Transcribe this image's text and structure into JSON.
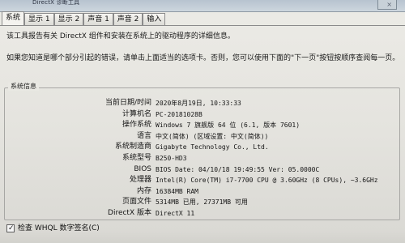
{
  "window": {
    "title": "DirectX 诊断工具",
    "close_icon": "close-icon"
  },
  "tabs": [
    {
      "label": "系统"
    },
    {
      "label": "显示 1"
    },
    {
      "label": "显示 2"
    },
    {
      "label": "声音 1"
    },
    {
      "label": "声音 2"
    },
    {
      "label": "输入"
    }
  ],
  "intro": {
    "line1": "该工具报告有关 DirectX 组件和安装在系统上的驱动程序的详细信息。",
    "line2": "如果您知道是哪个部分引起的错误，请单击上面适当的选项卡。否则，您可以使用下面的\"下一页\"按钮按顺序查阅每一页。"
  },
  "system_info": {
    "title": "系统信息",
    "rows": [
      {
        "label": "当前日期/时间",
        "value": "2020年8月19日, 10:33:33"
      },
      {
        "label": "计算机名",
        "value": "PC-20181028B"
      },
      {
        "label": "操作系统",
        "value": "Windows 7 旗舰版 64 位 (6.1, 版本 7601)"
      },
      {
        "label": "语言",
        "value": "中文(简体) (区域设置: 中文(简体))"
      },
      {
        "label": "系统制造商",
        "value": "Gigabyte Technology Co., Ltd."
      },
      {
        "label": "系统型号",
        "value": "B250-HD3"
      },
      {
        "label": "BIOS",
        "value": "BIOS Date: 04/10/18 19:49:55 Ver: 05.0000C"
      },
      {
        "label": "处理器",
        "value": "Intel(R) Core(TM) i7-7700 CPU @ 3.60GHz (8 CPUs), ~3.6GHz"
      },
      {
        "label": "内存",
        "value": "16384MB RAM"
      },
      {
        "label": "页面文件",
        "value": "5314MB 已用, 27371MB 可用"
      },
      {
        "label": "DirectX 版本",
        "value": "DirectX 11"
      }
    ]
  },
  "checkbox": {
    "label": "检查 WHQL 数字签名(C)",
    "checked": true,
    "check_mark": "✓"
  }
}
